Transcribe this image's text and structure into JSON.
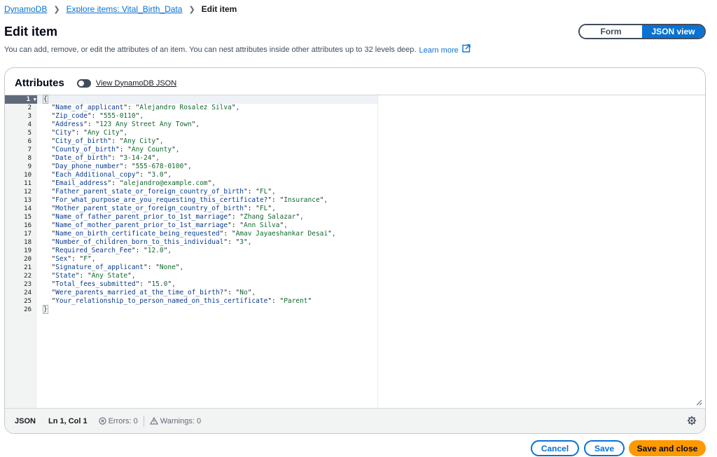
{
  "breadcrumb": {
    "items": [
      "DynamoDB",
      "Explore items: Vital_Birth_Data"
    ],
    "current": "Edit item"
  },
  "page": {
    "title": "Edit item",
    "description": "You can add, remove, or edit the attributes of an item. You can nest attributes inside other attributes up to 32 levels deep.",
    "learn_more": "Learn more"
  },
  "view_toggle": {
    "form": "Form",
    "json": "JSON view",
    "selected": "JSON view"
  },
  "attributes": {
    "title": "Attributes",
    "toggle_label": "View DynamoDB JSON",
    "toggle_on": false
  },
  "editor": {
    "lines": [
      {
        "n": "1",
        "open": "{"
      },
      {
        "n": "2",
        "k": "Name_of_applicant",
        "v": "Alejandro Rosalez Silva",
        "c": ","
      },
      {
        "n": "3",
        "k": "Zip_code",
        "v": "555-0110",
        "c": ","
      },
      {
        "n": "4",
        "k": "Address",
        "v": "123 Any Street Any Town",
        "c": ","
      },
      {
        "n": "5",
        "k": "City",
        "v": "Any City",
        "c": ","
      },
      {
        "n": "6",
        "k": "City_of_birth",
        "v": "Any City",
        "c": ","
      },
      {
        "n": "7",
        "k": "County_of_birth",
        "v": "Any County",
        "c": ","
      },
      {
        "n": "8",
        "k": "Date_of_birth",
        "v": "3-14-24",
        "c": ","
      },
      {
        "n": "9",
        "k": "Day_phone_number",
        "v": "555-678-0100",
        "c": ","
      },
      {
        "n": "10",
        "k": "Each_Additional_copy",
        "v": "3.0",
        "c": ","
      },
      {
        "n": "11",
        "k": "Email_address",
        "v": "alejandro@example.com",
        "c": ","
      },
      {
        "n": "12",
        "k": "Father_parent_state_or_foreign_country_of_birth",
        "v": "FL",
        "c": ","
      },
      {
        "n": "13",
        "k": "For_what_purpose_are_you_requesting_this_certificate?",
        "v": "Insurance",
        "c": ","
      },
      {
        "n": "14",
        "k": "Mother_parent_state_or_foreign_country_of_birth",
        "v": "FL",
        "c": ","
      },
      {
        "n": "15",
        "k": "Name_of_father_parent_prior_to_1st_marriage",
        "v": "Zhang Salazar",
        "c": ","
      },
      {
        "n": "16",
        "k": "Name_of_mother_parent_prior_to_1st_marriage",
        "v": "Ann Silva",
        "c": ","
      },
      {
        "n": "17",
        "k": "Name_on_birth_certificate_being_requested",
        "v": "Amav Jayaeshankar Desai",
        "c": ","
      },
      {
        "n": "18",
        "k": "Number_of_children_born_to_this_individual",
        "v": "3",
        "c": ","
      },
      {
        "n": "19",
        "k": "Required_Search_Fee",
        "v": "12.0",
        "c": ","
      },
      {
        "n": "20",
        "k": "Sex",
        "v": "F",
        "c": ","
      },
      {
        "n": "21",
        "k": "Signature_of_applicant",
        "v": "None",
        "c": ","
      },
      {
        "n": "22",
        "k": "State",
        "v": "Any State",
        "c": ","
      },
      {
        "n": "23",
        "k": "Total_fees_submitted",
        "v": "15.0",
        "c": ","
      },
      {
        "n": "24",
        "k": "Were_parents_married_at_the_time_of_birth?",
        "v": "No",
        "c": ","
      },
      {
        "n": "25",
        "k": "Your_relationship_to_person_named_on_this_certificate",
        "v": "Parent",
        "c": ""
      },
      {
        "n": "26",
        "close": "}"
      }
    ]
  },
  "status": {
    "mode": "JSON",
    "position": "Ln 1, Col 1",
    "errors": "Errors: 0",
    "warnings": "Warnings: 0"
  },
  "actions": {
    "cancel": "Cancel",
    "save": "Save",
    "save_close": "Save and close"
  },
  "colors": {
    "link": "#0972d3",
    "primary": "#ff9900",
    "segment_selected": "#0972d3"
  }
}
